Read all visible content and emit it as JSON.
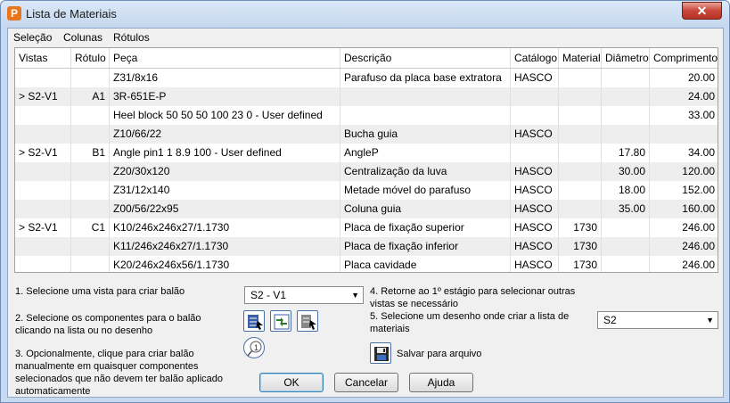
{
  "window": {
    "title": "Lista de Materiais",
    "app_icon_letter": "P",
    "close_glyph": "✕"
  },
  "menu": [
    "Seleção",
    "Colunas",
    "Rótulos"
  ],
  "table": {
    "columns": [
      "Vistas",
      "Rótulo",
      "Peça",
      "Descrição",
      "Catálogo",
      "Material",
      "Diâmetro",
      "Comprimento"
    ],
    "rows": [
      [
        "",
        "",
        "Z31/8x16",
        "Parafuso da placa base extratora",
        "HASCO",
        "",
        "",
        "20.00"
      ],
      [
        "> S2-V1",
        "A1",
        "3R-651E-P",
        "",
        "",
        "",
        "",
        "24.00"
      ],
      [
        "",
        "",
        "Heel block 50 50 50 100 23 0 - User defined",
        "",
        "",
        "",
        "",
        "33.00"
      ],
      [
        "",
        "",
        "Z10/66/22",
        "Bucha guia",
        "HASCO",
        "",
        "",
        ""
      ],
      [
        "> S2-V1",
        "B1",
        "Angle pin1 1 8.9 100 - User defined",
        "AngleP",
        "",
        "",
        "17.80",
        "34.00"
      ],
      [
        "",
        "",
        "Z20/30x120",
        "Centralização da luva",
        "HASCO",
        "",
        "30.00",
        "120.00"
      ],
      [
        "",
        "",
        "Z31/12x140",
        "Metade móvel do parafuso",
        "HASCO",
        "",
        "18.00",
        "152.00"
      ],
      [
        "",
        "",
        "Z00/56/22x95",
        "Coluna guia",
        "HASCO",
        "",
        "35.00",
        "160.00"
      ],
      [
        "> S2-V1",
        "C1",
        "K10/246x246x27/1.1730",
        "Placa de fixação superior",
        "HASCO",
        "1730",
        "",
        "246.00"
      ],
      [
        "",
        "",
        "K11/246x246x27/1.1730",
        "Placa de fixação inferior",
        "HASCO",
        "1730",
        "",
        "246.00"
      ],
      [
        "",
        "",
        "K20/246x246x56/1.1730",
        "Placa cavidade",
        "HASCO",
        "1730",
        "",
        "246.00"
      ]
    ]
  },
  "steps": {
    "step1": "1. Selecione uma vista para criar balão",
    "step2": "2. Selecione os componentes para o balão clicando na lista ou no desenho",
    "step3": "3. Opcionalmente, clique para criar balão manualmente em quaisquer componentes selecionados que não devem ter balão aplicado automaticamente",
    "step4": "4. Retorne ao 1º estágio para selecionar outras vistas se necessário",
    "step5": "5. Selecione um desenho onde criar a lista de materiais"
  },
  "view_select": {
    "value": "S2 - V1"
  },
  "drawing_select": {
    "value": "S2"
  },
  "save_label": "Salvar para arquivo",
  "buttons": {
    "ok": "OK",
    "cancel": "Cancelar",
    "help": "Ajuda"
  }
}
